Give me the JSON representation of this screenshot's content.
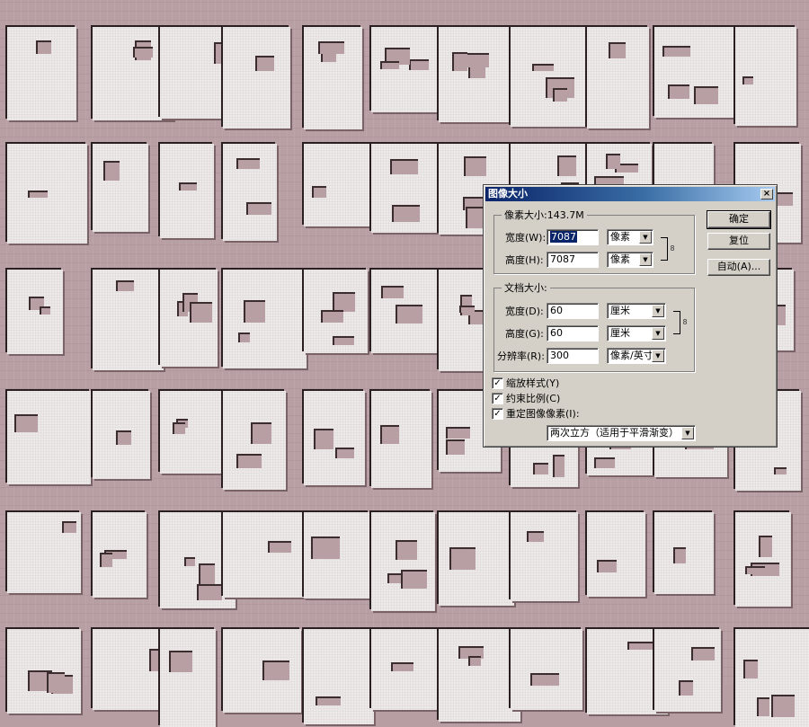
{
  "dialog": {
    "title": "图像大小",
    "close_glyph": "×",
    "pixel_dimensions": {
      "label": "像素大小:143.7M",
      "width": {
        "label": "宽度(W):",
        "value": "7087",
        "unit": "像素"
      },
      "height": {
        "label": "高度(H):",
        "value": "7087",
        "unit": "像素"
      }
    },
    "document_size": {
      "label": "文档大小:",
      "width": {
        "label": "宽度(D):",
        "value": "60",
        "unit": "厘米"
      },
      "height": {
        "label": "高度(G):",
        "value": "60",
        "unit": "厘米"
      },
      "resolution": {
        "label": "分辨率(R):",
        "value": "300",
        "unit": "像素/英寸"
      }
    },
    "options": {
      "scale_styles": {
        "label": "缩放样式(Y)",
        "checked": true
      },
      "constrain": {
        "label": "约束比例(C)",
        "checked": true
      },
      "resample": {
        "label": "重定图像像素(I):",
        "checked": true
      }
    },
    "resample_method": "两次立方（适用于平滑渐变）",
    "buttons": {
      "ok": "确定",
      "reset": "复位",
      "auto": "自动(A)..."
    },
    "check_glyph": "✓",
    "arrow_glyph": "▼",
    "link_glyph": "8"
  }
}
